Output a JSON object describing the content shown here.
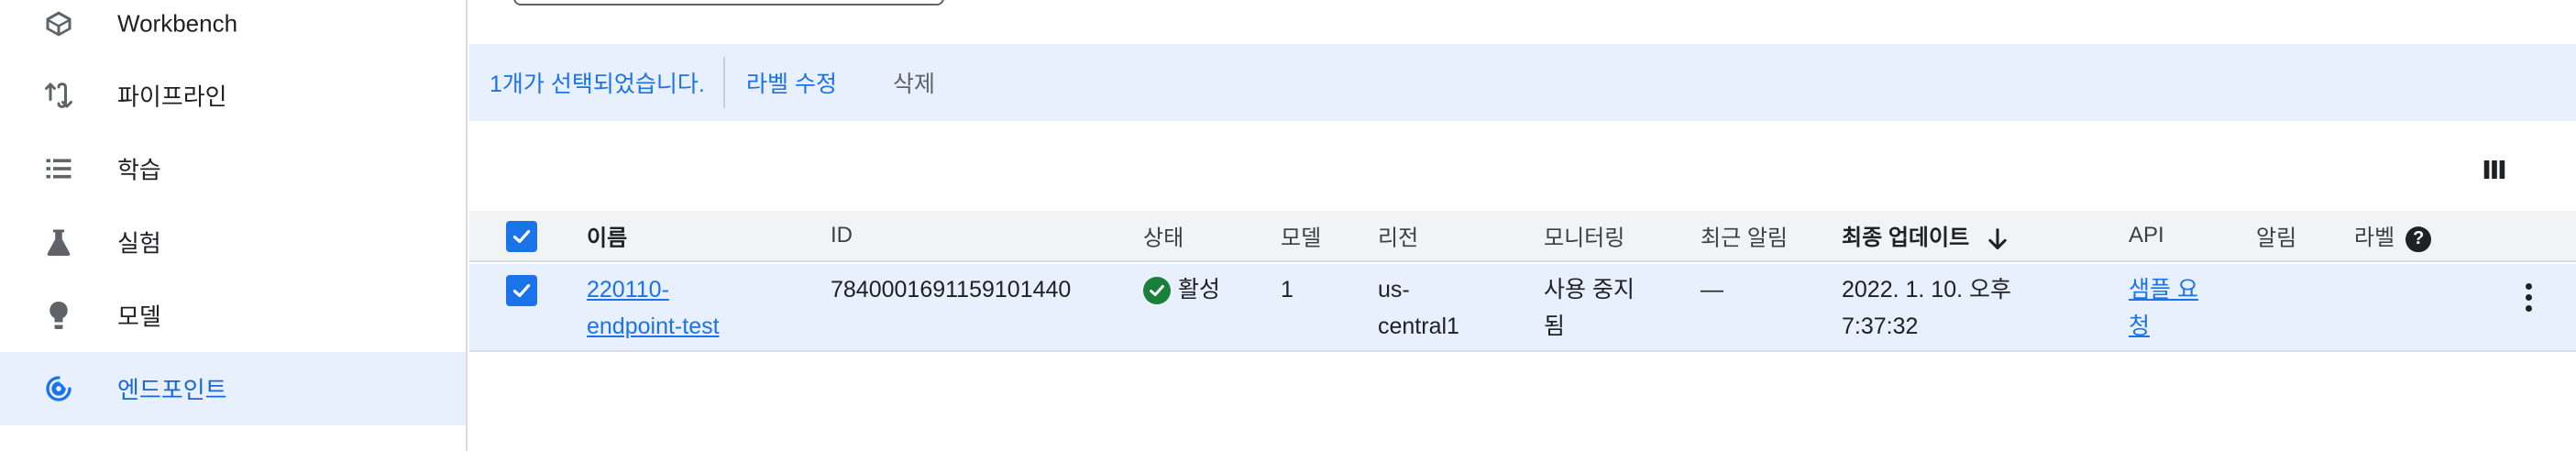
{
  "sidebar": {
    "items": [
      {
        "label": "Workbench",
        "icon": "workbench-icon"
      },
      {
        "label": "파이프라인",
        "icon": "pipeline-icon"
      },
      {
        "label": "학습",
        "icon": "training-list-icon"
      },
      {
        "label": "실험",
        "icon": "flask-icon"
      },
      {
        "label": "모델",
        "icon": "lightbulb-icon"
      },
      {
        "label": "엔드포인트",
        "icon": "endpoint-icon",
        "active": true
      }
    ]
  },
  "action_bar": {
    "selected_text": "1개가 선택되었습니다.",
    "edit_labels": "라벨 수정",
    "delete": "삭제"
  },
  "table": {
    "headers": {
      "name": "이름",
      "id": "ID",
      "status": "상태",
      "model": "모델",
      "region": "리전",
      "monitoring": "모니터링",
      "recent_alerts": "최근 알림",
      "last_update": "최종 업데이트",
      "api": "API",
      "alerts": "알림",
      "labels": "라벨"
    },
    "help_glyph": "?",
    "rows": [
      {
        "name_line1": "220110-",
        "name_line2": "endpoint-test",
        "id": "7840001691159101440",
        "status": "활성",
        "model": "1",
        "region_line1": "us-",
        "region_line2": "central1",
        "monitoring_line1": "사용 중지",
        "monitoring_line2": "됨",
        "recent_alerts": "—",
        "last_update_line1": "2022. 1. 10. 오후",
        "last_update_line2": "7:37:32",
        "api_line1": "샘플 요",
        "api_line2": "청"
      }
    ]
  },
  "colors": {
    "accent": "#1a73e8",
    "selection_bg": "#e8f0fe",
    "header_bg": "#f1f3f4",
    "status_green": "#188038"
  }
}
